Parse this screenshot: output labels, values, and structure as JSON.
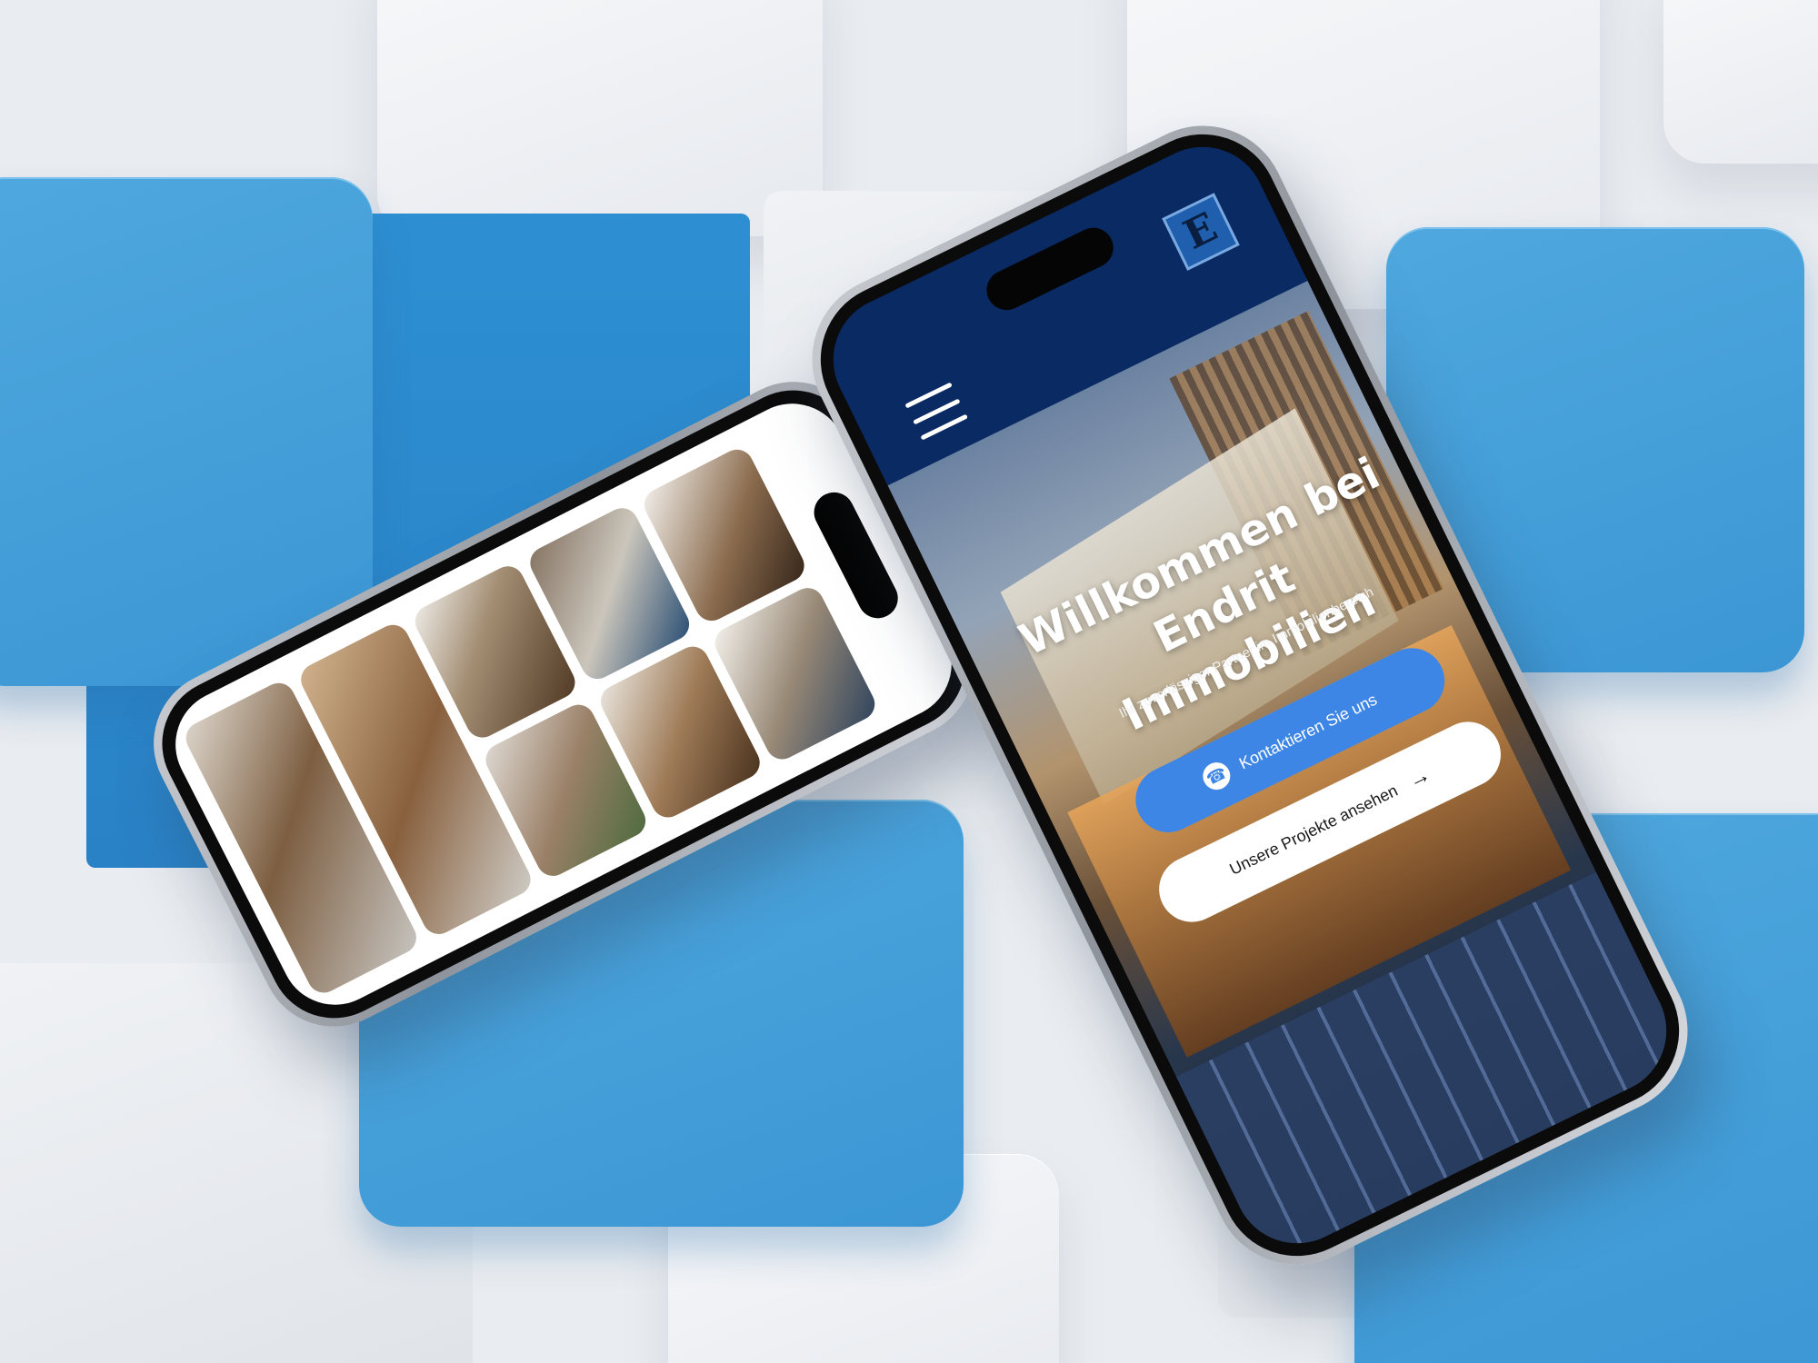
{
  "scene": {
    "description_colors": {
      "background": "#e9ecf0",
      "tile_blue": "#3b96d4",
      "tile_white": "#f2f4f7"
    }
  },
  "website": {
    "brand": {
      "logo_letter": "E",
      "header_color": "#0a2a63"
    },
    "menu_icon": "hamburger-icon",
    "hero": {
      "title": "Willkommen bei Endrit Immobilien",
      "subtitle": "Ihr zuverlässiger Partner im Immobilienbereich"
    },
    "buttons": {
      "primary": {
        "label": "Kontaktieren Sie uns",
        "icon": "phone-icon",
        "color": "#3e86e6"
      },
      "secondary": {
        "label": "Unsere Projekte ansehen",
        "icon": "arrow-right-icon"
      }
    }
  },
  "gallery": {
    "photos": [
      {
        "alt": "interior-photo-1"
      },
      {
        "alt": "interior-photo-2"
      },
      {
        "alt": "interior-photo-3"
      },
      {
        "alt": "interior-photo-4"
      },
      {
        "alt": "interior-photo-5"
      },
      {
        "alt": "interior-photo-6"
      },
      {
        "alt": "interior-photo-7"
      },
      {
        "alt": "interior-photo-8"
      }
    ]
  }
}
